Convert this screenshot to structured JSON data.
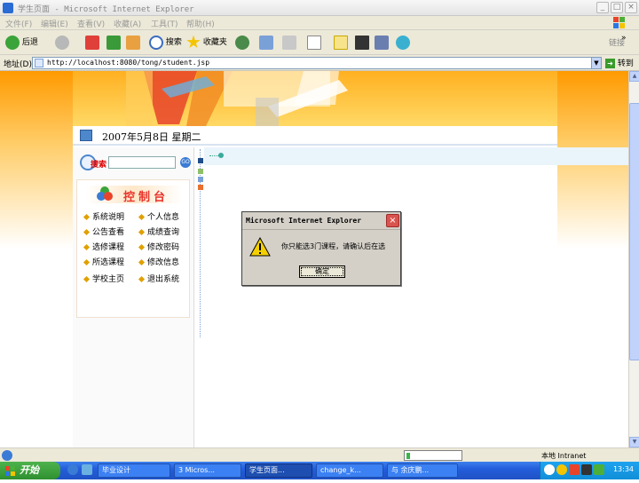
{
  "window": {
    "title": "学生页面 - Microsoft Internet Explorer",
    "min_label": "_",
    "max_label": "□",
    "close_label": "×"
  },
  "menu": [
    "文件(F)",
    "编辑(E)",
    "查看(V)",
    "收藏(A)",
    "工具(T)",
    "帮助(H)"
  ],
  "toolbar": {
    "back_label": "后退",
    "search_label": "搜索",
    "favorites_label": "收藏夹",
    "links_label": "链接",
    "chevron": "»"
  },
  "address": {
    "label": "地址(D)",
    "url": "http://localhost:8080/tong/student.jsp",
    "go_label": "转到",
    "go_arrow": "➜",
    "dropdown": "▼"
  },
  "page": {
    "date": "2007年5月8日  星期二",
    "search_label": "搜索",
    "search_go": "GO",
    "control_title": "控制台",
    "nav_left": [
      "系统说明",
      "公告查看",
      "选修课程",
      "所选课程",
      "学校主页"
    ],
    "nav_right": [
      "个人信息",
      "成绩查询",
      "修改密码",
      "修改信息",
      "退出系统"
    ]
  },
  "dialog": {
    "title": "Microsoft Internet Explorer",
    "message": "你只能选3门课程，请确认后在选",
    "ok_label": "确定",
    "close_label": "×"
  },
  "scrollbar": {
    "up": "▲",
    "down": "▼"
  },
  "status": {
    "zone": "本地 Intranet"
  },
  "taskbar": {
    "start_label": "开始",
    "tasks": [
      "毕业设计",
      "3 Micros...",
      "学生页面...",
      "change_k...",
      "与 余庆鹏..."
    ],
    "clock": "13:34"
  },
  "colors": {
    "banner": "#ffb020",
    "taskbar": "#245edb",
    "start": "#2f8f2f",
    "dialog_bg": "#d4d0c8",
    "control_title": "#e8332a"
  }
}
